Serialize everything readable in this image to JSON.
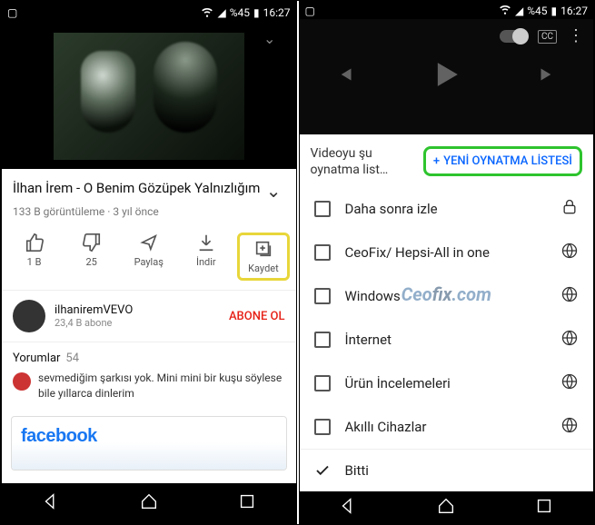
{
  "status": {
    "battery": "%45",
    "time": "16:27"
  },
  "left": {
    "title": "İlhan İrem - O Benim Gözüpek Yalnızlığım",
    "views": "133 B görüntüleme",
    "age": "3 yıl önce",
    "actions": {
      "like": "1 B",
      "dislike": "25",
      "share": "Paylaş",
      "download": "İndir",
      "save": "Kaydet"
    },
    "channel": {
      "name": "ilhaniremVEVO",
      "subs": "23,4 B abone",
      "subscribe": "ABONE OL"
    },
    "comments": {
      "label": "Yorumlar",
      "count": "54",
      "top": "sevmediğim şarkısı yok. Mini mini bir kuşu söylese bile yıllarca dinlerim"
    },
    "card": "facebook"
  },
  "right": {
    "sheet_title": "Videoyu şu oynatma list…",
    "new_label": "YENİ OYNATMA LİSTESİ",
    "items": [
      {
        "label": "Daha sonra izle",
        "priv": "lock"
      },
      {
        "label": "CeoFix/ Hepsi-All in one",
        "priv": "globe"
      },
      {
        "label": "Windows",
        "priv": "globe"
      },
      {
        "label": "İnternet",
        "priv": "globe"
      },
      {
        "label": "Ürün İncelemeleri",
        "priv": "globe"
      },
      {
        "label": "Akıllı Cihazlar",
        "priv": "globe"
      }
    ],
    "done": "Bitti"
  },
  "watermark": "Ceofix.com"
}
